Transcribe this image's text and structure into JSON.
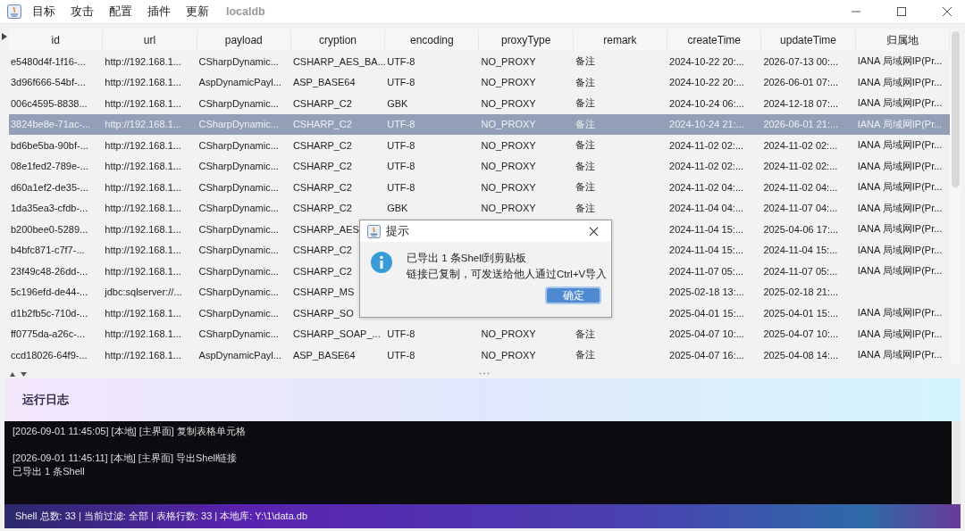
{
  "menu": [
    {
      "label": "目标",
      "kind": "item"
    },
    {
      "label": "攻击",
      "kind": "item"
    },
    {
      "label": "配置",
      "kind": "item"
    },
    {
      "label": "插件",
      "kind": "item"
    },
    {
      "label": "更新",
      "kind": "item"
    },
    {
      "label": "localdb",
      "kind": "title"
    }
  ],
  "table": {
    "columns": [
      "id",
      "url",
      "payload",
      "cryption",
      "encoding",
      "proxyType",
      "remark",
      "createTime",
      "updateTime",
      "归属地"
    ],
    "rows": [
      {
        "selected": false,
        "cells": [
          "e5480d4f-1f16-...",
          "http://192.168.1...",
          "CSharpDynamic...",
          "CSHARP_AES_BA...",
          "UTF-8",
          "NO_PROXY",
          "备注",
          "2024-10-22 20:...",
          "2026-07-13 00:...",
          "IANA 局域网IP(Pr..."
        ]
      },
      {
        "selected": false,
        "cells": [
          "3d96f666-54bf-...",
          "http://192.168.1...",
          "AspDynamicPayl...",
          "ASP_BASE64",
          "UTF-8",
          "NO_PROXY",
          "备注",
          "2024-10-22 20:...",
          "2026-06-01 07:...",
          "IANA 局域网IP(Pr..."
        ]
      },
      {
        "selected": false,
        "cells": [
          "006c4595-8838...",
          "http://192.168.1...",
          "CSharpDynamic...",
          "CSHARP_C2",
          "GBK",
          "NO_PROXY",
          "备注",
          "2024-10-24 06:...",
          "2024-12-18 07:...",
          "IANA 局域网IP(Pr..."
        ]
      },
      {
        "selected": true,
        "cells": [
          "3824be8e-71ac-...",
          "http://192.168.1...",
          "CSharpDynamic...",
          "CSHARP_C2",
          "UTF-8",
          "NO_PROXY",
          "备注",
          "2024-10-24 21:...",
          "2026-06-01 21:...",
          "IANA 局域网IP(Pr..."
        ]
      },
      {
        "selected": false,
        "cells": [
          "bd6be5ba-90bf-...",
          "http://192.168.1...",
          "CSharpDynamic...",
          "CSHARP_C2",
          "UTF-8",
          "NO_PROXY",
          "备注",
          "2024-11-02 02:...",
          "2024-11-02 02:...",
          "IANA 局域网IP(Pr..."
        ]
      },
      {
        "selected": false,
        "cells": [
          "08e1fed2-789e-...",
          "http://192.168.1...",
          "CSharpDynamic...",
          "CSHARP_C2",
          "UTF-8",
          "NO_PROXY",
          "备注",
          "2024-11-02 02:...",
          "2024-11-02 02:...",
          "IANA 局域网IP(Pr..."
        ]
      },
      {
        "selected": false,
        "cells": [
          "d60a1ef2-de35-...",
          "http://192.168.1...",
          "CSharpDynamic...",
          "CSHARP_C2",
          "UTF-8",
          "NO_PROXY",
          "备注",
          "2024-11-02 04:...",
          "2024-11-02 04:...",
          "IANA 局域网IP(Pr..."
        ]
      },
      {
        "selected": false,
        "cells": [
          "1da35ea3-cfdb-...",
          "http://192.168.1...",
          "CSharpDynamic...",
          "CSHARP_C2",
          "GBK",
          "NO_PROXY",
          "备注",
          "2024-11-04 04:...",
          "2024-11-07 04:...",
          "IANA 局域网IP(Pr..."
        ]
      },
      {
        "selected": false,
        "cells": [
          "b200bee0-5289...",
          "http://192.168.1...",
          "CSharpDynamic...",
          "CSHARP_AES",
          null,
          null,
          null,
          "2024-11-04 15:...",
          "2025-04-06 17:...",
          "IANA 局域网IP(Pr..."
        ]
      },
      {
        "selected": false,
        "cells": [
          "b4bfc871-c7f7-...",
          "http://192.168.1...",
          "CSharpDynamic...",
          "CSHARP_C2",
          null,
          null,
          null,
          "2024-11-04 15:...",
          "2024-11-04 15:...",
          "IANA 局域网IP(Pr..."
        ]
      },
      {
        "selected": false,
        "cells": [
          "23f49c48-26dd-...",
          "http://192.168.1...",
          "CSharpDynamic...",
          "CSHARP_C2",
          null,
          null,
          null,
          "2024-11-07 05:...",
          "2024-11-07 05:...",
          "IANA 局域网IP(Pr..."
        ]
      },
      {
        "selected": false,
        "cells": [
          "5c196efd-de44-...",
          "jdbc:sqlserver://...",
          "CSharpDynamic...",
          "CSHARP_MS",
          null,
          null,
          null,
          "2025-02-18 13:...",
          "2025-02-18 21:...",
          null
        ]
      },
      {
        "selected": false,
        "cells": [
          "d1b2fb5c-710d-...",
          "http://192.168.1...",
          "CSharpDynamic...",
          "CSHARP_SO",
          null,
          null,
          null,
          "2025-04-01 15:...",
          "2025-04-01 15:...",
          "IANA 局域网IP(Pr..."
        ]
      },
      {
        "selected": false,
        "cells": [
          "ff0775da-a26c-...",
          "http://192.168.1...",
          "CSharpDynamic...",
          "CSHARP_SOAP_...",
          "UTF-8",
          "NO_PROXY",
          "备注",
          "2025-04-07 10:...",
          "2025-04-07 10:...",
          "IANA 局域网IP(Pr..."
        ]
      },
      {
        "selected": false,
        "cells": [
          "ccd18026-64f9-...",
          "http://192.168.1...",
          "AspDynamicPayl...",
          "ASP_BASE64",
          "UTF-8",
          "NO_PROXY",
          "备注",
          "2025-04-07 16:...",
          "2025-04-08 14:...",
          "IANA 局域网IP(Pr..."
        ]
      }
    ]
  },
  "log": {
    "title": "运行日志",
    "entries": [
      {
        "lines": [
          "[2026-09-01 11:45:05] [本地] [主界面] 复制表格单元格"
        ]
      },
      {
        "lines": [
          "[2026-09-01 11:45:11] [本地] [主界面] 导出Shell链接",
          "已导出 1 条Shell"
        ]
      }
    ]
  },
  "status_bar": "Shell 总数: 33 | 当前过滤: 全部 | 表格行数: 33 | 本地库: Y:\\1\\data.db",
  "dialog": {
    "title": "提示",
    "lines": [
      "已导出 1 条Shell到剪贴板",
      "链接已复制，可发送给他人通过Ctrl+V导入"
    ],
    "button": "确定"
  }
}
